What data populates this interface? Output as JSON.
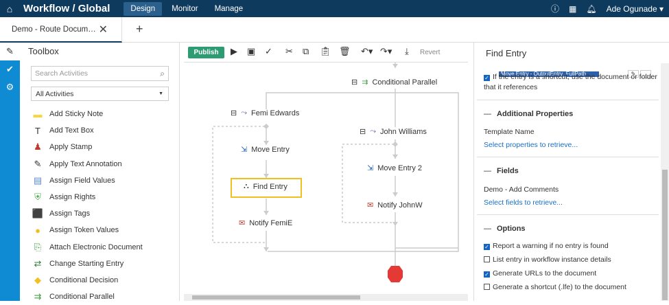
{
  "app": {
    "title": "Workflow / Global",
    "nav": [
      "Design",
      "Monitor",
      "Manage"
    ],
    "active_nav": "Design",
    "user": "Ade Ogunade"
  },
  "tabs": {
    "doc_tab": "Demo - Route Docum…",
    "add": "+"
  },
  "toolbox": {
    "title": "Toolbox",
    "search_placeholder": "Search Activities",
    "filter": "All Activities",
    "items": [
      {
        "label": "Add Sticky Note",
        "icon": "sticky-note-icon",
        "color": "#f5d63d"
      },
      {
        "label": "Add Text Box",
        "icon": "text-box-icon",
        "color": "#333333"
      },
      {
        "label": "Apply Stamp",
        "icon": "stamp-icon",
        "color": "#c0392b"
      },
      {
        "label": "Apply Text Annotation",
        "icon": "annotation-icon",
        "color": "#333333"
      },
      {
        "label": "Assign Field Values",
        "icon": "field-values-icon",
        "color": "#5b8bd6"
      },
      {
        "label": "Assign Rights",
        "icon": "rights-icon",
        "color": "#4caf50"
      },
      {
        "label": "Assign Tags",
        "icon": "tags-icon",
        "color": "#1e5bb8"
      },
      {
        "label": "Assign Token Values",
        "icon": "token-icon",
        "color": "#f0c020"
      },
      {
        "label": "Attach Electronic Document",
        "icon": "attach-icon",
        "color": "#43a047"
      },
      {
        "label": "Change Starting Entry",
        "icon": "starting-entry-icon",
        "color": "#2e7d32"
      },
      {
        "label": "Conditional Decision",
        "icon": "decision-icon",
        "color": "#f0c020"
      },
      {
        "label": "Conditional Parallel",
        "icon": "parallel-icon",
        "color": "#43a047"
      }
    ]
  },
  "canvas": {
    "publish": "Publish",
    "revert": "Revert",
    "nodes": {
      "conditional_parallel": "Conditional Parallel",
      "branch_left": "Femi Edwards",
      "move_entry": "Move Entry",
      "find_entry": "Find Entry",
      "notify_femie": "Notify FemiE",
      "branch_right": "John Williams",
      "move_entry_2": "Move Entry 2",
      "notify_johnw": "Notify JohnW"
    }
  },
  "props": {
    "title": "Find Entry",
    "prev_field": "Move Entry - OutputEntry_FullPath",
    "shortcut_opt": "If the entry is a shortcut, use the document or folder",
    "shortcut_opt2": "that it references",
    "shortcut_checked": true,
    "additional_section": "Additional Properties",
    "template_label": "Template Name",
    "template_link": "Select properties to retrieve...",
    "fields_section": "Fields",
    "fields_label": "Demo - Add Comments",
    "fields_link": "Select fields to retrieve...",
    "options_section": "Options",
    "options": [
      {
        "label": "Report a warning if no entry is found",
        "checked": true
      },
      {
        "label": "List entry in workflow instance details",
        "checked": false
      },
      {
        "label": "Generate URLs to the document",
        "checked": true
      },
      {
        "label": "Generate a shortcut (.lfe) to the document",
        "checked": false
      }
    ]
  }
}
